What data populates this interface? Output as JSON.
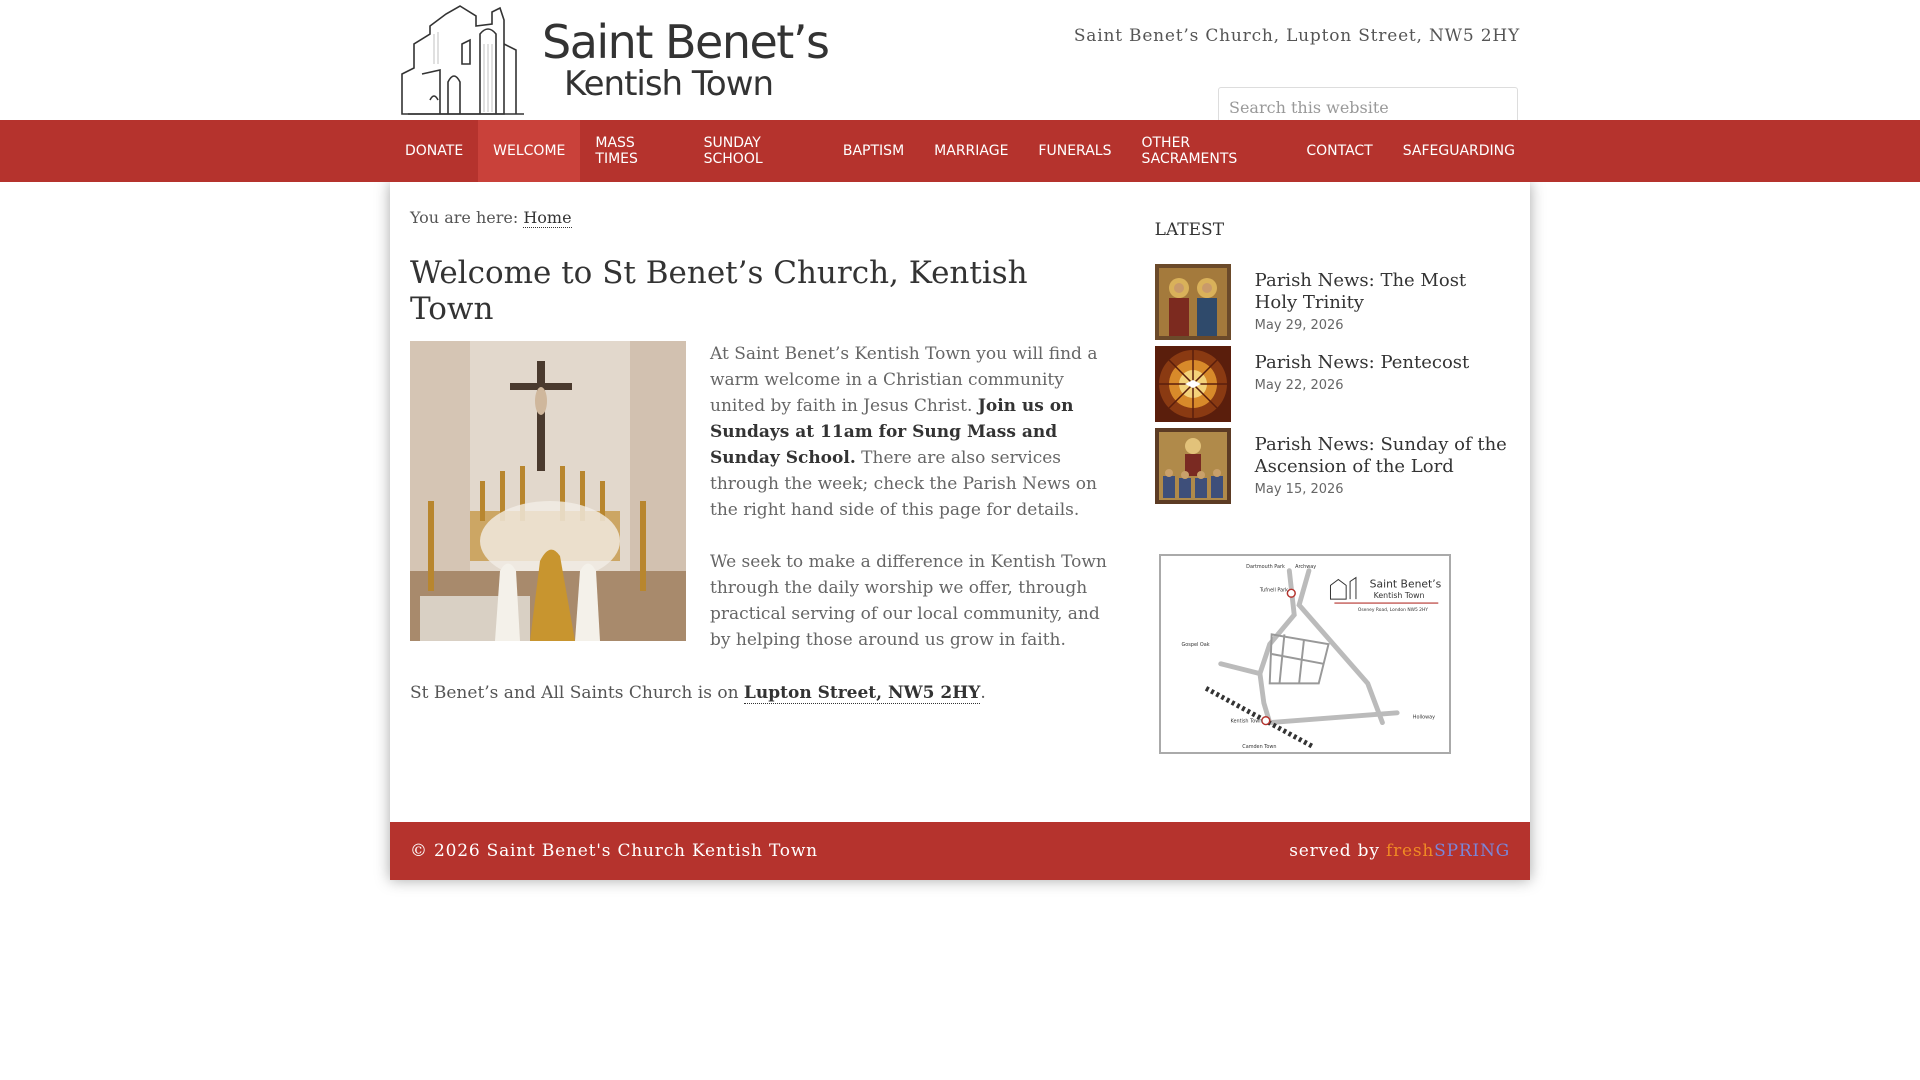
{
  "header": {
    "logo_line1": "Saint Benet’s",
    "logo_line2": "Kentish Town",
    "address": "Saint Benet’s Church, Lupton Street, NW5 2HY",
    "search_placeholder": "Search this website"
  },
  "nav": {
    "items": [
      {
        "label": "DONATE"
      },
      {
        "label": "WELCOME"
      },
      {
        "label": "MASS TIMES"
      },
      {
        "label": "SUNDAY SCHOOL"
      },
      {
        "label": "BAPTISM"
      },
      {
        "label": "MARRIAGE"
      },
      {
        "label": "FUNERALS"
      },
      {
        "label": "OTHER SACRAMENTS"
      },
      {
        "label": "CONTACT"
      },
      {
        "label": "SAFEGUARDING"
      }
    ],
    "active": "WELCOME"
  },
  "breadcrumb": {
    "prefix": "You are here:",
    "home": "Home"
  },
  "main": {
    "title": "Welcome to St Benet’s Church, Kentish Town",
    "para1_a": "At Saint Benet’s Kentish Town you will find a warm welcome in a Christian community united by faith in Jesus Christ.",
    "para1_bold": "Join us on Sundays at 11am for Sung Mass and Sunday School.",
    "para1_b": "There are also services through the week; check the Parish News on the right hand side of this page for details.",
    "para2": "We seek to make a difference in Kentish Town through the daily worship we offer, through practical serving of our local community, and by helping those around us grow in faith.",
    "location_prefix": "St Benet’s and All Saints Church is on",
    "location_link": "Lupton Street, NW5 2HY",
    "location_suffix": "."
  },
  "sidebar": {
    "heading": "LATEST",
    "posts": [
      {
        "title": "Parish News: The Most Holy Trinity",
        "date": "May 29, 2026"
      },
      {
        "title": "Parish News: Pentecost",
        "date": "May 22, 2026"
      },
      {
        "title": "Parish News: Sunday of the Ascension of the Lord",
        "date": "May 15, 2026"
      }
    ],
    "map_labels": {
      "dartmouth": "Dartmouth Park",
      "archway": "Archway",
      "tufnell": "Tufnell Park",
      "gospel": "Gospel Oak",
      "kentish": "Kentish Town",
      "camden": "Camden Town",
      "holloway": "Holloway",
      "logo1": "Saint Benet’s",
      "logo2": "Kentish Town",
      "road": "Oseney Road, London NW5 2HY"
    }
  },
  "footer": {
    "copyright": "© 2026 Saint Benet's Church Kentish Town",
    "served_by": "served by",
    "fresh": "fresh",
    "spring": "SPRING"
  },
  "colors": {
    "accent": "#b5332d",
    "nav_active": "#c9413a",
    "fresh": "#f08a24",
    "spring": "#7a86d9"
  }
}
